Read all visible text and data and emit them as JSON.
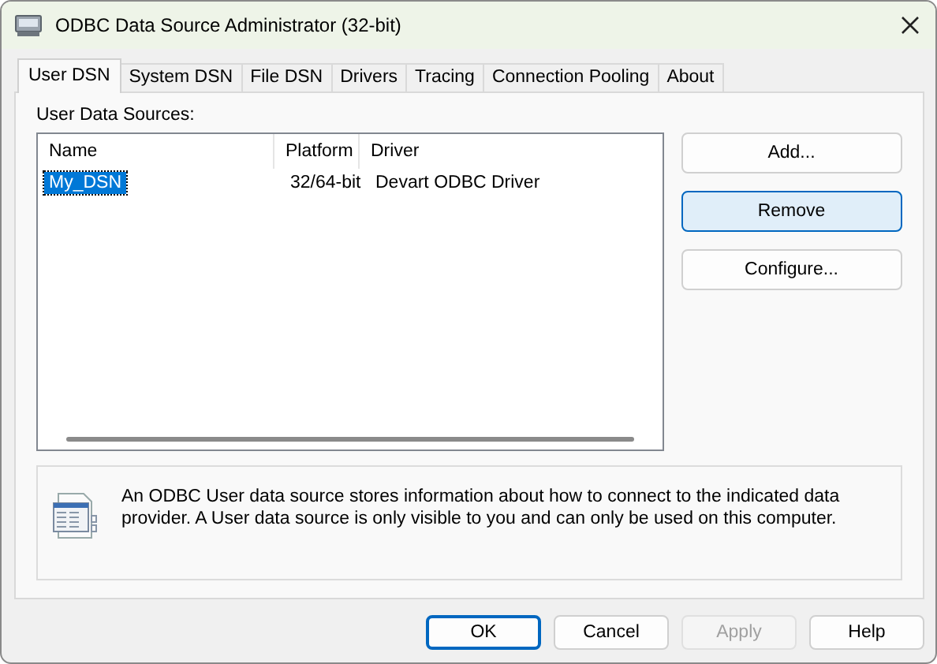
{
  "window": {
    "title": "ODBC Data Source Administrator (32-bit)"
  },
  "tabs": [
    {
      "label": "User DSN",
      "selected": true
    },
    {
      "label": "System DSN",
      "selected": false
    },
    {
      "label": "File DSN",
      "selected": false
    },
    {
      "label": "Drivers",
      "selected": false
    },
    {
      "label": "Tracing",
      "selected": false
    },
    {
      "label": "Connection Pooling",
      "selected": false
    },
    {
      "label": "About",
      "selected": false
    }
  ],
  "section_label": "User Data Sources:",
  "table": {
    "columns": [
      "Name",
      "Platform",
      "Driver"
    ],
    "rows": [
      {
        "cells": [
          "My_DSN",
          "32/64-bit",
          "Devart ODBC Driver"
        ],
        "selected": true
      }
    ]
  },
  "side_buttons": [
    {
      "label": "Add...",
      "focused": false
    },
    {
      "label": "Remove",
      "focused": true
    },
    {
      "label": "Configure...",
      "focused": false
    }
  ],
  "info_text": "An ODBC User data source stores information about how to connect to the indicated data provider.   A User data source is only visible to you and can only be used on this computer.",
  "buttons": [
    {
      "label": "OK",
      "default": true,
      "disabled": false
    },
    {
      "label": "Cancel",
      "default": false,
      "disabled": false
    },
    {
      "label": "Apply",
      "default": false,
      "disabled": true
    },
    {
      "label": "Help",
      "default": false,
      "disabled": false
    }
  ]
}
